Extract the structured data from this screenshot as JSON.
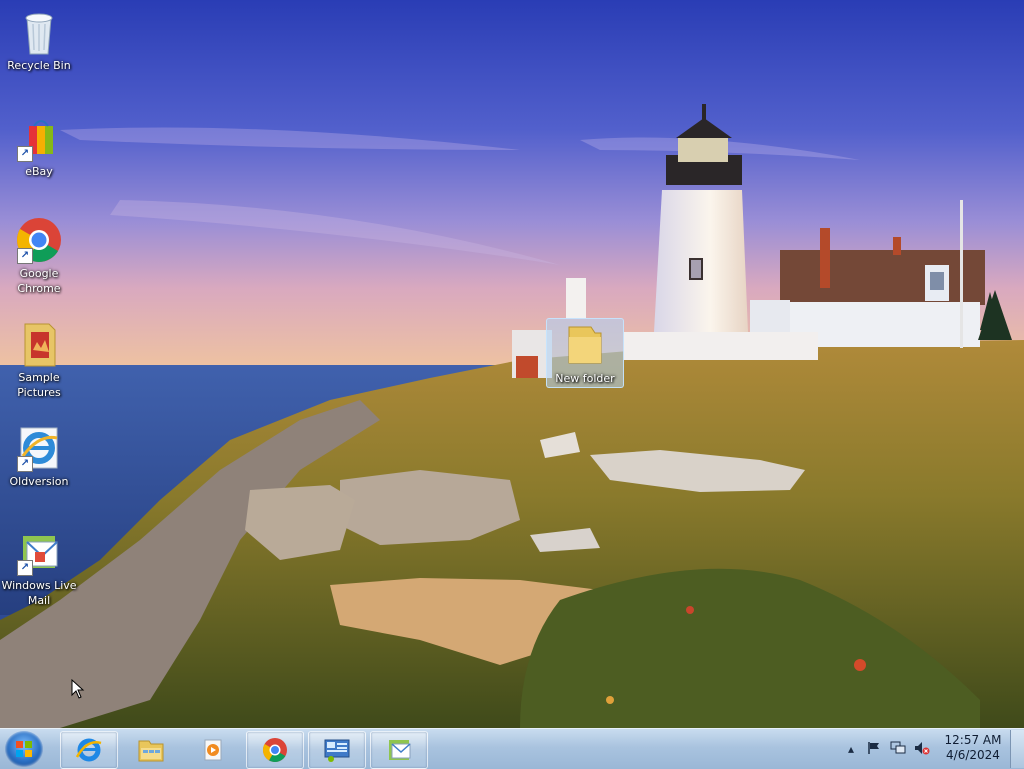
{
  "desktop": {
    "icons": [
      {
        "label": "Recycle Bin",
        "icon": "recycle-bin-icon"
      },
      {
        "label": "eBay",
        "icon": "ebay-icon"
      },
      {
        "label": "Google Chrome",
        "icon": "chrome-icon"
      },
      {
        "label": "Sample Pictures",
        "icon": "folder-icon"
      },
      {
        "label": "Oldversion",
        "icon": "ie-icon"
      },
      {
        "label": "Windows Live Mail",
        "icon": "mail-icon"
      }
    ],
    "selected_item": {
      "label": "New folder",
      "icon": "folder-icon"
    }
  },
  "taskbar": {
    "start_label": "Start",
    "pinned": [
      {
        "name": "Internet Explorer",
        "icon": "ie-icon"
      },
      {
        "name": "Windows Explorer",
        "icon": "explorer-icon"
      },
      {
        "name": "Windows Media Player",
        "icon": "media-player-icon"
      },
      {
        "name": "Google Chrome",
        "icon": "chrome-icon"
      },
      {
        "name": "Control Panel",
        "icon": "control-panel-icon"
      },
      {
        "name": "Windows Live Mail",
        "icon": "mail-icon"
      }
    ],
    "tray": {
      "time": "12:57 AM",
      "date": "4/6/2024"
    }
  }
}
